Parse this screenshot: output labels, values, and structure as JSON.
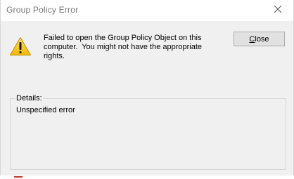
{
  "window": {
    "title": "Group Policy Error"
  },
  "dialog": {
    "message": "Failed to open the Group Policy Object on this\ncomputer.  You might not have the appropriate\nrights.",
    "close_button": {
      "accel": "C",
      "rest": "lose"
    },
    "details": {
      "label": "Details:",
      "text": "Unspecified error"
    }
  },
  "icons": {
    "title_close": "close-icon",
    "warning": "warning-icon"
  },
  "colors": {
    "warning_yellow": "#f6c21c",
    "title_text": "#777777",
    "dialog_bg": "#f0f0f0",
    "button_bg": "#e1e1e1"
  }
}
